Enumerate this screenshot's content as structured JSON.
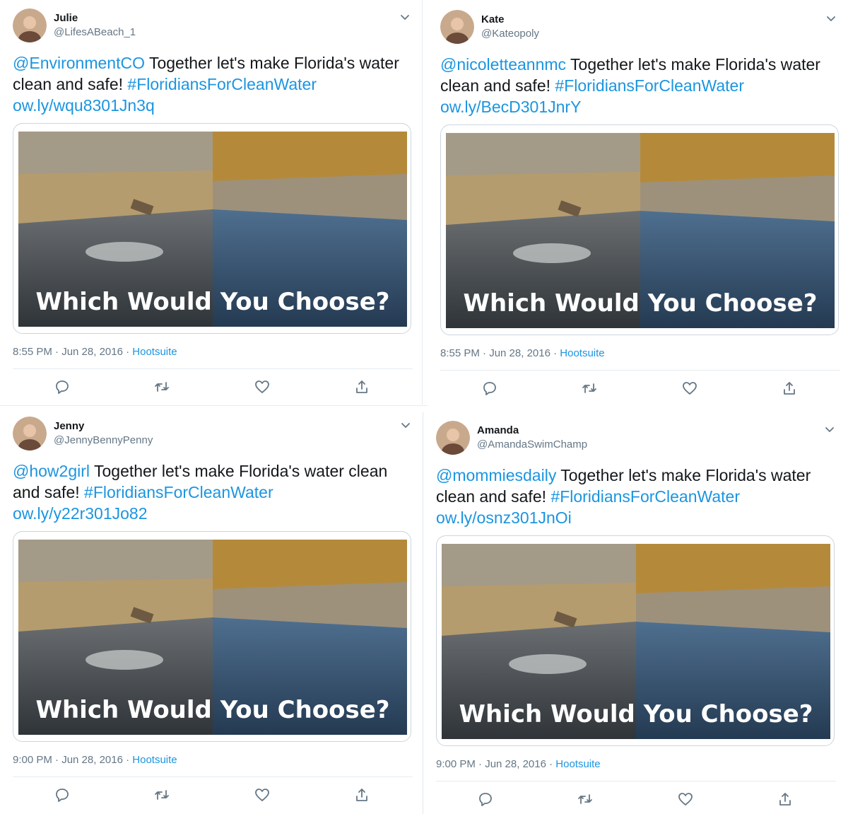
{
  "tweets": [
    {
      "name": "Julie",
      "handle": "@LifesABeach_1",
      "mention": "@EnvironmentCO",
      "body": " Together let's make Florida's water clean and safe! ",
      "hashtag": "#FloridiansForCleanWater",
      "link": "ow.ly/wqu8301Jn3q",
      "image_caption": "Which Would You Choose?",
      "time": "8:55 PM · Jun 28, 2016 · ",
      "source": "Hootsuite"
    },
    {
      "name": "Kate",
      "handle": "@Kateopoly",
      "mention": "@nicoletteannmc",
      "body": " Together let's make Florida's water clean and safe! ",
      "hashtag": "#FloridiansForCleanWater",
      "link": "ow.ly/BecD301JnrY",
      "image_caption": "Which Would You Choose?",
      "time": "8:55 PM · Jun 28, 2016 · ",
      "source": "Hootsuite"
    },
    {
      "name": "Jenny",
      "handle": "@JennyBennyPenny",
      "mention": "@how2girl",
      "body": " Together let's make Florida's water clean and safe! ",
      "hashtag": "#FloridiansForCleanWater",
      "link": "ow.ly/y22r301Jo82",
      "image_caption": "Which Would You Choose?",
      "time": "9:00 PM · Jun 28, 2016 · ",
      "source": "Hootsuite"
    },
    {
      "name": "Amanda",
      "handle": "@AmandaSwimChamp",
      "mention": "@mommiesdaily",
      "body": " Together let's make Florida's water clean and safe! ",
      "hashtag": "#FloridiansForCleanWater",
      "link": "ow.ly/osnz301JnOi",
      "image_caption": "Which Would You Choose?",
      "time": "9:00 PM · Jun 28, 2016 · ",
      "source": "Hootsuite"
    }
  ],
  "icons": {
    "more": "chevron-down-icon",
    "reply": "reply-icon",
    "retweet": "retweet-icon",
    "like": "heart-icon",
    "share": "share-icon"
  },
  "colors": {
    "link": "#1b95e0",
    "secondary_text": "#657786",
    "border": "#ccd6dd"
  }
}
